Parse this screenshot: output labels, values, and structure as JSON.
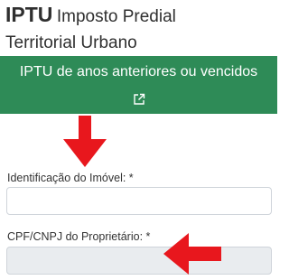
{
  "header": {
    "abbr": "IPTU",
    "title_line1": "Imposto Predial",
    "title_line2": "Territorial Urbano"
  },
  "banner": {
    "label": "IPTU de anos anteriores ou vencidos",
    "icon": "external-link-icon",
    "color": "#2e8b57"
  },
  "form": {
    "property_id": {
      "label": "Identificação do Imóvel: *",
      "value": ""
    },
    "owner_doc": {
      "label": "CPF/CNPJ do Proprietário: *",
      "value": ""
    }
  },
  "annotations": {
    "arrow_color": "#e8171d"
  }
}
